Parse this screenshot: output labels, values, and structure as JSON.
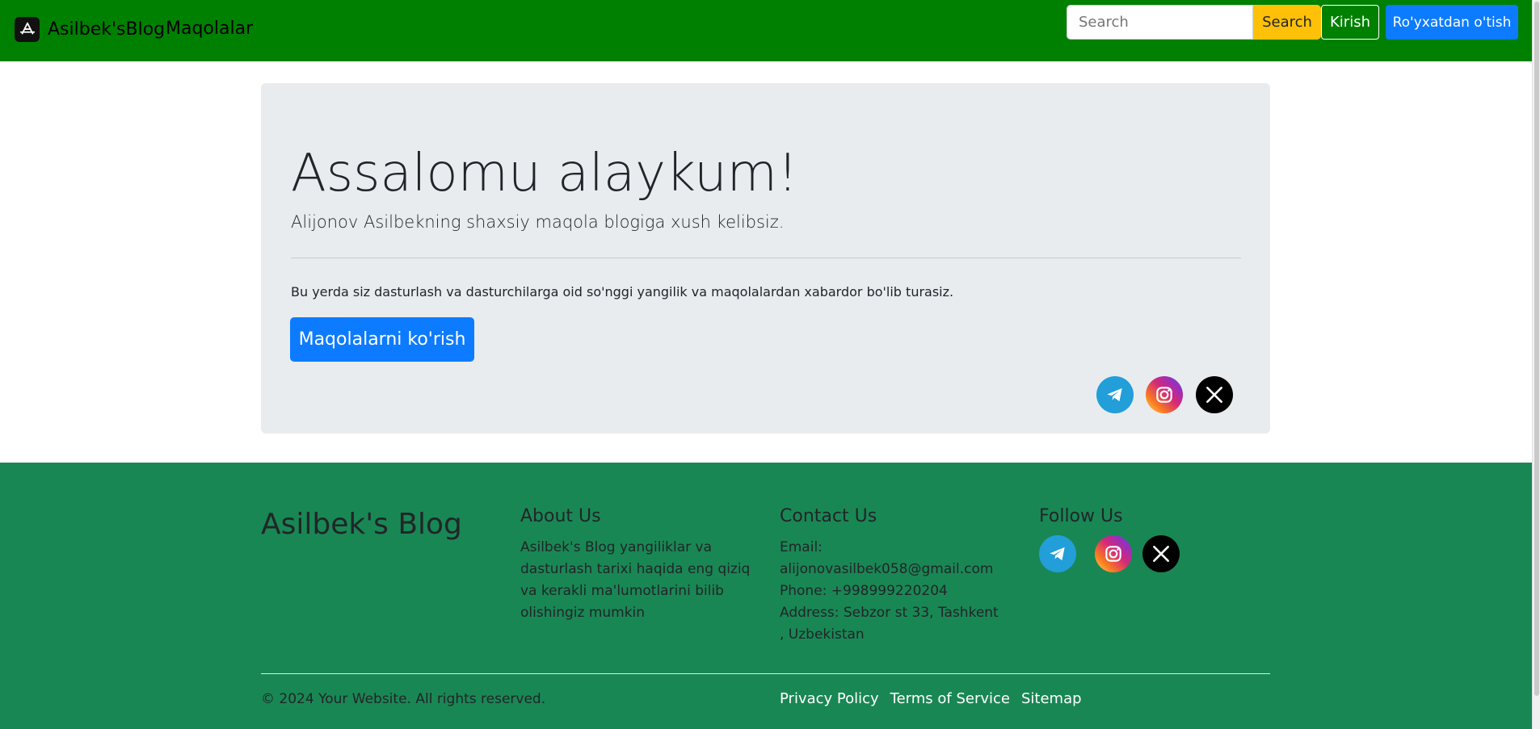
{
  "navbar": {
    "brand": "Asilbek'sBlog",
    "nav_link": "Maqolalar",
    "search_placeholder": "Search",
    "search_button": "Search",
    "login_button": "Kirish",
    "register_button": "Ro'yxatdan o'tish"
  },
  "jumbotron": {
    "title": "Assalomu alaykum!",
    "lead": "Alijonov Asilbekning shaxsiy maqola blogiga xush kelibsiz.",
    "text": "Bu yerda siz dasturlash va dasturchilarga oid so'nggi yangilik va maqolalardan xabardor bo'lib turasiz.",
    "button": "Maqolalarni ko'rish",
    "socials": [
      "telegram-icon",
      "instagram-icon",
      "x-icon"
    ]
  },
  "footer": {
    "brand": "Asilbek's Blog",
    "about": {
      "title": "About Us",
      "body": "Asilbek's Blog yangiliklar va dasturlash tarixi haqida eng qiziq va kerakli ma'lumotlarini bilib olishingiz mumkin"
    },
    "contact": {
      "title": "Contact Us",
      "email": "Email: alijonovasilbek058@gmail.com",
      "phone": "Phone: +998999220204",
      "address": "Address: Sebzor st 33, Tashkent , Uzbekistan"
    },
    "follow": {
      "title": "Follow Us",
      "socials": [
        "telegram-icon",
        "instagram-icon",
        "x-icon"
      ]
    },
    "copyright": "© 2024 Your Website. All rights reserved.",
    "links": [
      "Privacy Policy",
      "Terms of Service",
      "Sitemap"
    ]
  },
  "colors": {
    "navbar": "#008000",
    "footer": "#198754",
    "primary": "#0d7bff",
    "warning": "#ffc107",
    "jumbotron": "#e9ecef"
  }
}
